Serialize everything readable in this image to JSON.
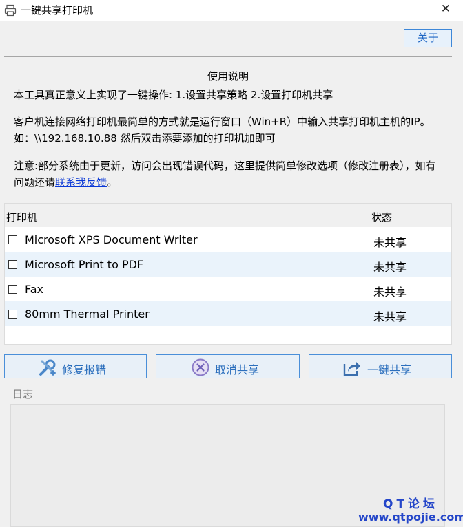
{
  "window": {
    "title": "一键共享打印机",
    "close_glyph": "✕",
    "app_icon": "printer-icon"
  },
  "toolbar": {
    "about_label": "关于"
  },
  "instructions": {
    "title": "使用说明",
    "line1": "本工具真正意义上实现了一键操作:  1.设置共享策略 2.设置打印机共享",
    "line2": "客户机连接网络打印机最简单的方式就是运行窗口（Win+R）中输入共享打印机主机的IP。如：\\\\192.168.10.88 然后双击添要添加的打印机加即可",
    "line3_prefix": "注意:部分系统由于更新，访问会出现错误代码，这里提供简单修改选项（修改注册表），如有问题还请",
    "line3_link": "联系我反馈",
    "line3_suffix": "。"
  },
  "printer_table": {
    "columns": [
      "打印机",
      "状态"
    ],
    "rows": [
      {
        "name": "Microsoft XPS Document Writer",
        "status": "未共享",
        "checked": false
      },
      {
        "name": "Microsoft Print to PDF",
        "status": "未共享",
        "checked": false
      },
      {
        "name": "Fax",
        "status": "未共享",
        "checked": false
      },
      {
        "name": "80mm Thermal Printer",
        "status": "未共享",
        "checked": false
      }
    ]
  },
  "actions": {
    "repair_label": "修复报错",
    "repair_icon": "wrench-screwdriver-icon",
    "cancel_label": "取消共享",
    "cancel_icon": "cancel-circle-icon",
    "share_label": "一键共享",
    "share_icon": "share-arrow-icon"
  },
  "log": {
    "title": "日志",
    "content": ""
  },
  "watermark": {
    "line1": "QT论坛",
    "line2": "www.qtpojie.com"
  },
  "colors": {
    "accent_blue": "#3d87d8",
    "link_blue": "#0b39d6",
    "alt_row": "#eaf3fb",
    "watermark": "#2446c9"
  }
}
